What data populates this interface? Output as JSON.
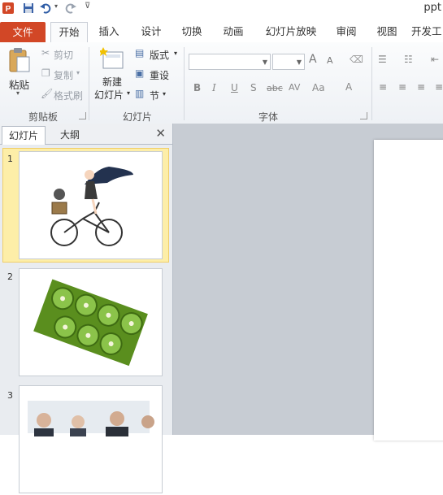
{
  "window": {
    "title_partial": "ppt"
  },
  "quick_access": {
    "app_icon": "powerpoint-icon",
    "save_icon": "save-icon",
    "undo_icon": "undo-icon",
    "redo_icon": "redo-icon",
    "customize_icon": "customize-qat-icon"
  },
  "tabs": [
    {
      "label": "文件"
    },
    {
      "label": "开始"
    },
    {
      "label": "插入"
    },
    {
      "label": "设计"
    },
    {
      "label": "切换"
    },
    {
      "label": "动画"
    },
    {
      "label": "幻灯片放映"
    },
    {
      "label": "审阅"
    },
    {
      "label": "视图"
    },
    {
      "label": "开发工"
    }
  ],
  "ribbon": {
    "clipboard": {
      "paste": "粘贴",
      "cut": "剪切",
      "copy": "复制",
      "format_painter": "格式刷",
      "group": "剪贴板"
    },
    "slides": {
      "new_slide_line1": "新建",
      "new_slide_line2": "幻灯片",
      "layout": "版式",
      "reset": "重设",
      "section": "节",
      "group": "幻灯片"
    },
    "font": {
      "font_name": "",
      "font_size": "",
      "grow": "A",
      "shrink": "A",
      "bold": "B",
      "italic": "I",
      "underline": "U",
      "shadow": "S",
      "strike": "abc",
      "spacing": "AV",
      "case": "Aa",
      "color": "A",
      "group": "字体"
    }
  },
  "pane": {
    "tabs": [
      "幻灯片",
      "大纲"
    ],
    "close": "✕",
    "slides": [
      {
        "num": "1",
        "content": "girl riding bicycle with cat illustration"
      },
      {
        "num": "2",
        "content": "kiwi slices photo"
      },
      {
        "num": "3",
        "content": "business people photo"
      }
    ]
  },
  "colors": {
    "file_tab": "#d24726",
    "selection": "#fdeea8",
    "workspace": "#c7ccd3"
  }
}
